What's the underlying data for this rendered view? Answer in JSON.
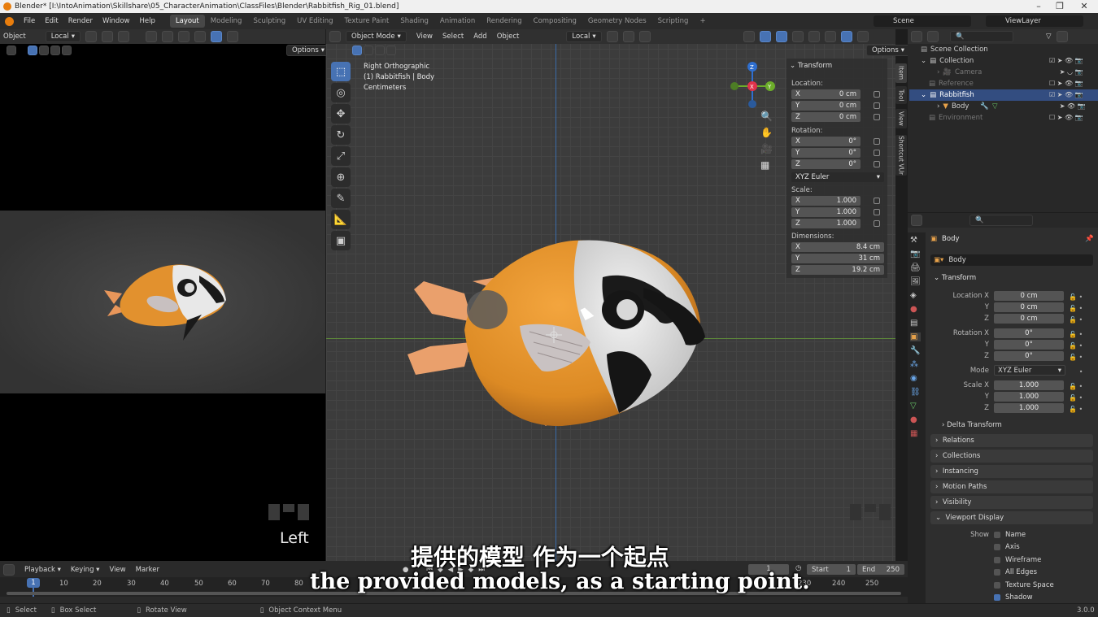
{
  "window": {
    "title": "Blender* [I:\\IntoAnimation\\Skillshare\\05_CharacterAnimation\\ClassFiles\\Blender\\Rabbitfish_Rig_01.blend]"
  },
  "menu": [
    "File",
    "Edit",
    "Render",
    "Window",
    "Help"
  ],
  "workspaces": [
    "Layout",
    "Modeling",
    "Sculpting",
    "UV Editing",
    "Texture Paint",
    "Shading",
    "Animation",
    "Rendering",
    "Compositing",
    "Geometry Nodes",
    "Scripting"
  ],
  "active_workspace": "Layout",
  "scene_name": "Scene",
  "view_layer": "ViewLayer",
  "left_view": {
    "object_label": "Object",
    "orientation": "Local",
    "options": "Options",
    "view_label": "Left"
  },
  "main_view": {
    "mode": "Object Mode",
    "menus": [
      "View",
      "Select",
      "Add",
      "Object"
    ],
    "orientation": "Local",
    "options": "Options",
    "info_line1": "Right Orthographic",
    "info_line2": "(1) Rabbitfish | Body",
    "info_line3": "Centimeters",
    "gizmo": {
      "x": "X",
      "y": "Y",
      "z": "Z"
    }
  },
  "npanel": {
    "tabs": [
      "Item",
      "Tool",
      "View",
      "Shortcut VUr"
    ],
    "header": "Transform",
    "location_label": "Location:",
    "location": [
      {
        "axis": "X",
        "value": "0 cm"
      },
      {
        "axis": "Y",
        "value": "0 cm"
      },
      {
        "axis": "Z",
        "value": "0 cm"
      }
    ],
    "rotation_label": "Rotation:",
    "rotation": [
      {
        "axis": "X",
        "value": "0°"
      },
      {
        "axis": "Y",
        "value": "0°"
      },
      {
        "axis": "Z",
        "value": "0°"
      }
    ],
    "rotation_mode": "XYZ Euler",
    "scale_label": "Scale:",
    "scale": [
      {
        "axis": "X",
        "value": "1.000"
      },
      {
        "axis": "Y",
        "value": "1.000"
      },
      {
        "axis": "Z",
        "value": "1.000"
      }
    ],
    "dimensions_label": "Dimensions:",
    "dimensions": [
      {
        "axis": "X",
        "value": "8.4 cm"
      },
      {
        "axis": "Y",
        "value": "31 cm"
      },
      {
        "axis": "Z",
        "value": "19.2 cm"
      }
    ]
  },
  "outliner": {
    "items": [
      {
        "name": "Scene Collection"
      },
      {
        "name": "Collection"
      },
      {
        "name": "Camera"
      },
      {
        "name": "Reference"
      },
      {
        "name": "Rabbitfish"
      },
      {
        "name": "Body"
      },
      {
        "name": "Environment"
      }
    ]
  },
  "properties": {
    "object_name": "Body",
    "data_name": "Body",
    "transform_header": "Transform",
    "location_labels": [
      "Location X",
      "Y",
      "Z"
    ],
    "location": [
      "0 cm",
      "0 cm",
      "0 cm"
    ],
    "rotation_labels": [
      "Rotation X",
      "Y",
      "Z"
    ],
    "rotation": [
      "0°",
      "0°",
      "0°"
    ],
    "mode_label": "Mode",
    "mode": "XYZ Euler",
    "scale_labels": [
      "Scale X",
      "Y",
      "Z"
    ],
    "scale": [
      "1.000",
      "1.000",
      "1.000"
    ],
    "delta_transform": "Delta Transform",
    "sections": [
      "Relations",
      "Collections",
      "Instancing",
      "Motion Paths",
      "Visibility",
      "Viewport Display"
    ],
    "show_label": "Show",
    "show_options": [
      {
        "label": "Name",
        "checked": false
      },
      {
        "label": "Axis",
        "checked": false
      },
      {
        "label": "Wireframe",
        "checked": false
      },
      {
        "label": "All Edges",
        "checked": false
      },
      {
        "label": "Texture Space",
        "checked": false
      },
      {
        "label": "Shadow",
        "checked": true
      }
    ]
  },
  "timeline": {
    "menus": [
      "Playback",
      "Keying",
      "View",
      "Marker"
    ],
    "current_frame": "1",
    "start_label": "Start",
    "start": "1",
    "end_label": "End",
    "end": "250",
    "ticks": [
      "10",
      "20",
      "30",
      "40",
      "50",
      "60",
      "70",
      "80",
      "230",
      "240",
      "250"
    ],
    "playhead": "1"
  },
  "statusbar": {
    "items": [
      "Select",
      "Box Select",
      "Rotate View",
      "Object Context Menu"
    ],
    "version": "3.0.0"
  },
  "subtitles": {
    "cn": "提供的模型 作为一个起点",
    "en": "the provided models, as a starting point."
  }
}
